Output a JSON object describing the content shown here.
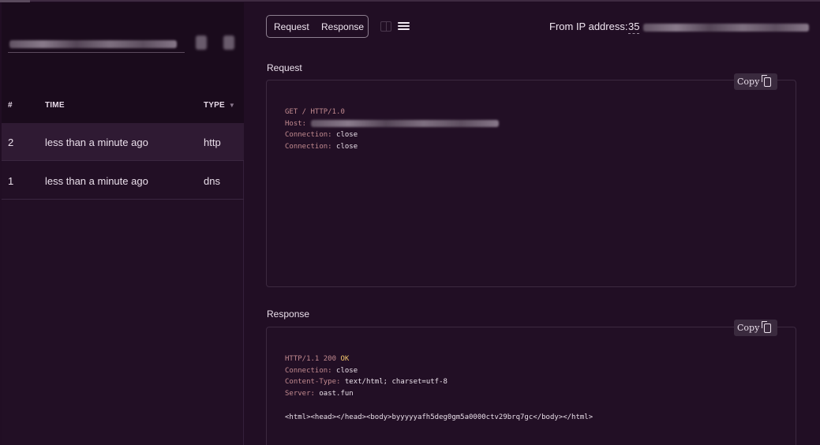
{
  "sidebar": {
    "columns": {
      "number": "#",
      "time": "TIME",
      "type": "TYPE"
    },
    "rows": [
      {
        "id": "2",
        "time": "less than a minute ago",
        "type": "http"
      },
      {
        "id": "1",
        "time": "less than a minute ago",
        "type": "dns"
      }
    ],
    "selected_row": 0
  },
  "toolbar": {
    "request_tab": "Request",
    "response_tab": "Response",
    "from_ip_label": "From IP address:",
    "ip_prefix": "35"
  },
  "request": {
    "title": "Request",
    "copy_label": "Copy",
    "line1": "GET / HTTP/1.0",
    "host_key": "Host:",
    "conn1_key": "Connection:",
    "conn1_val": "close",
    "conn2_key": "Connection:",
    "conn2_val": "close"
  },
  "response": {
    "title": "Response",
    "copy_label": "Copy",
    "status_proto": "HTTP/1.1 200",
    "status_text": "OK",
    "conn_key": "Connection:",
    "conn_val": "close",
    "ctype_key": "Content-Type:",
    "ctype_val": "text/html; charset=utf-8",
    "server_key": "Server:",
    "server_val": "oast.fun",
    "body": "<html><head></head><body>byyyyyafh5deg0gm5a0000ctv29brq7gc</body></html>"
  },
  "colors": {
    "background": "#210e24",
    "sidebar_header": "#1a0b1c",
    "selected_row": "#2f1a33",
    "header_key": "#c28a8f",
    "status_ok": "#f0c36b"
  },
  "icons": [
    "split-view-icon",
    "full-view-icon",
    "copy-icon",
    "sort-arrow-icon"
  ]
}
